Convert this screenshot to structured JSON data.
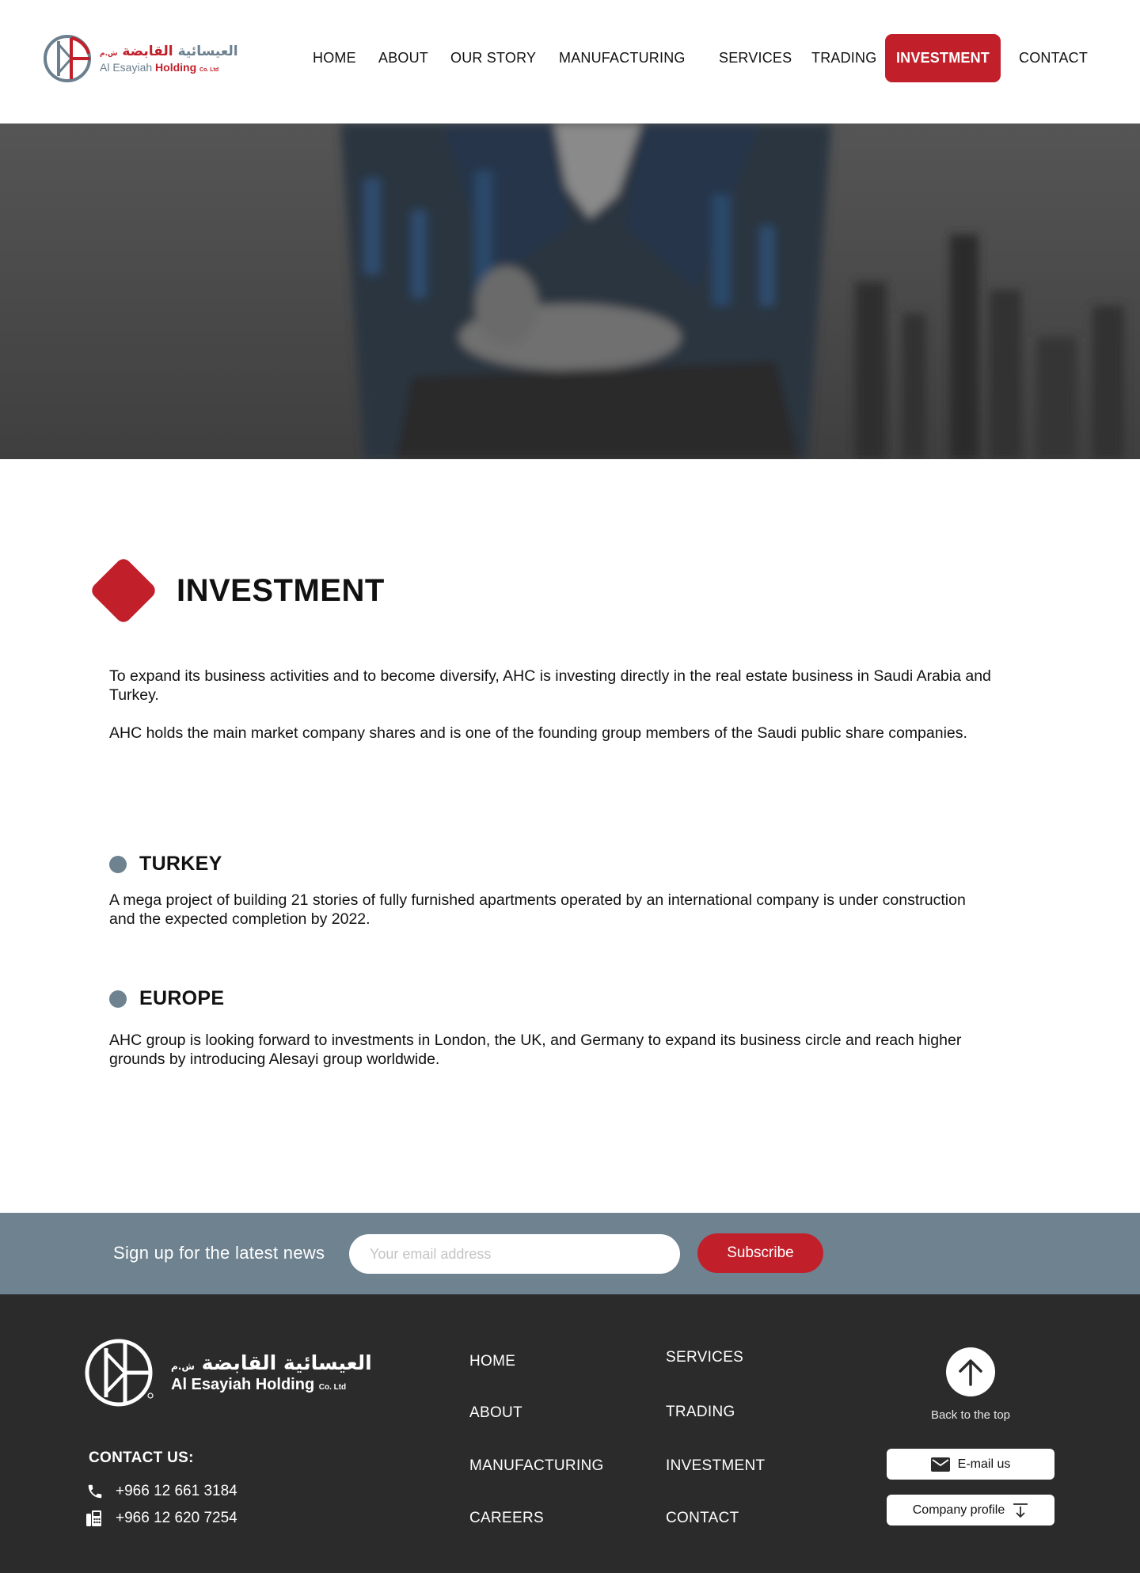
{
  "brand": {
    "arabic_main": "العيسائية",
    "arabic_highlight": "القابضة",
    "arabic_suffix": "ش.م",
    "english_main": "Al Esayiah",
    "english_highlight": "Holding",
    "english_suffix": "Co. Ltd"
  },
  "nav": {
    "items": [
      {
        "label": "HOME"
      },
      {
        "label": "ABOUT"
      },
      {
        "label": "OUR STORY"
      },
      {
        "label": "MANUFACTURING"
      },
      {
        "label": "SERVICES"
      },
      {
        "label": "TRADING"
      },
      {
        "label": "INVESTMENT",
        "active": true
      },
      {
        "label": "CONTACT"
      }
    ]
  },
  "main": {
    "title": "INVESTMENT",
    "intro": [
      "To expand its business activities and to become diversify, AHC is investing directly in the real estate business in Saudi Arabia and Turkey.",
      "AHC holds the main market company shares and is one of the founding group members of the Saudi public share companies."
    ],
    "sections": [
      {
        "title": "TURKEY",
        "text": "A mega project of building 21 stories of fully furnished apartments operated by an international company is under construction and the expected completion by 2022."
      },
      {
        "title": "EUROPE",
        "text": "AHC group is looking forward to investments in London, the UK, and Germany to expand its business circle and reach higher grounds by introducing Alesayi group worldwide."
      }
    ]
  },
  "newsletter": {
    "label": "Sign up for the latest news",
    "placeholder": "Your email address",
    "button": "Subscribe"
  },
  "footer": {
    "contact_label": "CONTACT US:",
    "phone": "+966 12 661 3184",
    "fax": "+966 12 620 7254",
    "links_col1": [
      "HOME",
      "ABOUT",
      "MANUFACTURING",
      "CAREERS"
    ],
    "links_col2": [
      "SERVICES",
      "TRADING",
      "INVESTMENT",
      "CONTACT"
    ],
    "back_to_top": "Back to the top",
    "email_btn": "E-mail us",
    "profile_btn": "Company profile"
  },
  "colors": {
    "brand_red": "#c1202b",
    "slate": "#6f8290",
    "footer_bg": "#2b2b2b"
  },
  "icons": {
    "phone": "phone-icon",
    "fax": "fax-icon",
    "email": "envelope-icon",
    "download": "download-icon",
    "back_to_top": "arrow-up-icon"
  }
}
